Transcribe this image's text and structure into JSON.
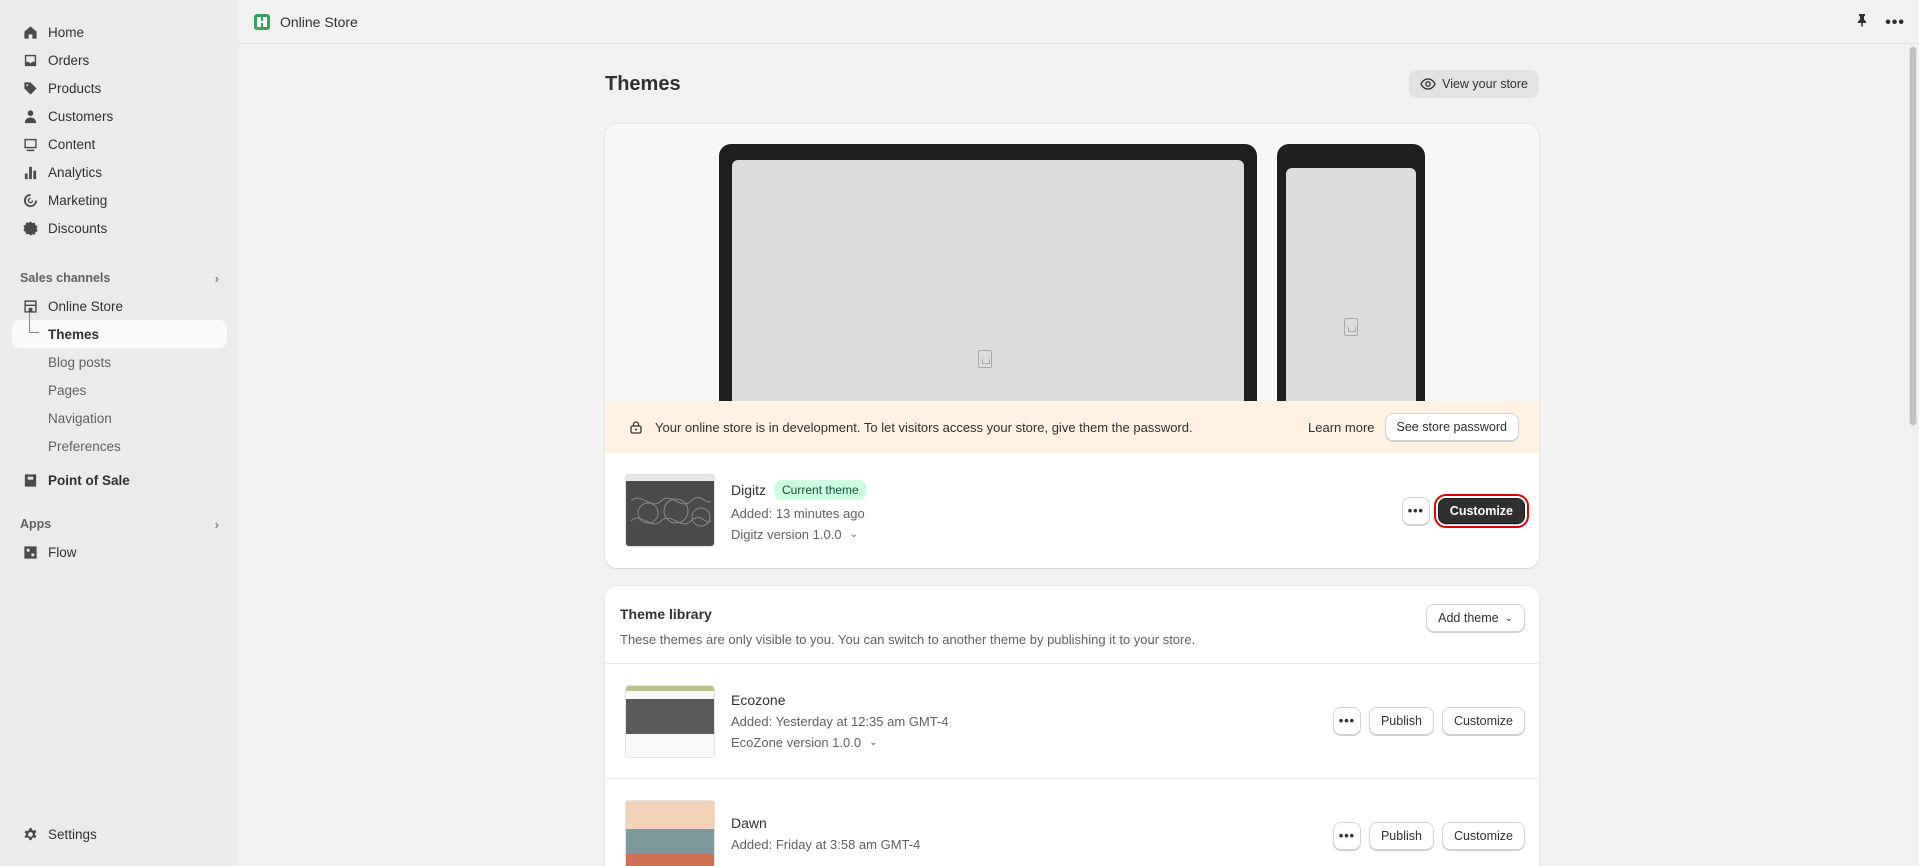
{
  "sidebar": {
    "nav": [
      {
        "label": "Home",
        "icon": "home-icon"
      },
      {
        "label": "Orders",
        "icon": "inbox-icon"
      },
      {
        "label": "Products",
        "icon": "tag-icon"
      },
      {
        "label": "Customers",
        "icon": "person-icon"
      },
      {
        "label": "Content",
        "icon": "content-icon"
      },
      {
        "label": "Analytics",
        "icon": "bar-chart-icon"
      },
      {
        "label": "Marketing",
        "icon": "target-icon"
      },
      {
        "label": "Discounts",
        "icon": "discount-icon"
      }
    ],
    "sales_channels_label": "Sales channels",
    "online_store": "Online Store",
    "sub_items": [
      "Themes",
      "Blog posts",
      "Pages",
      "Navigation",
      "Preferences"
    ],
    "point_of_sale": "Point of Sale",
    "apps_label": "Apps",
    "flow": "Flow",
    "settings": "Settings"
  },
  "topbar": {
    "title": "Online Store"
  },
  "page": {
    "title": "Themes",
    "view_store": "View your store"
  },
  "banner": {
    "message": "Your online store is in development. To let visitors access your store, give them the password.",
    "learn_more": "Learn more",
    "see_password": "See store password"
  },
  "current_theme": {
    "name": "Digitz",
    "badge": "Current theme",
    "added": "Added: 13 minutes ago",
    "version": "Digitz version 1.0.0",
    "dots": "•••",
    "customize": "Customize"
  },
  "library": {
    "title": "Theme library",
    "description": "These themes are only visible to you. You can switch to another theme by publishing it to your store.",
    "add_theme": "Add theme",
    "themes": [
      {
        "name": "Ecozone",
        "added": "Added: Yesterday at 12:35 am GMT-4",
        "version": "EcoZone version 1.0.0",
        "publish": "Publish",
        "customize": "Customize",
        "dots": "•••"
      },
      {
        "name": "Dawn",
        "added": "Added: Friday at 3:58 am GMT-4",
        "version": "",
        "publish": "Publish",
        "customize": "Customize",
        "dots": "•••"
      }
    ]
  },
  "colors": {
    "accent": "#303030",
    "badge_bg": "#cdfee1",
    "banner_bg": "#fff2e3",
    "highlight": "#e00000"
  }
}
